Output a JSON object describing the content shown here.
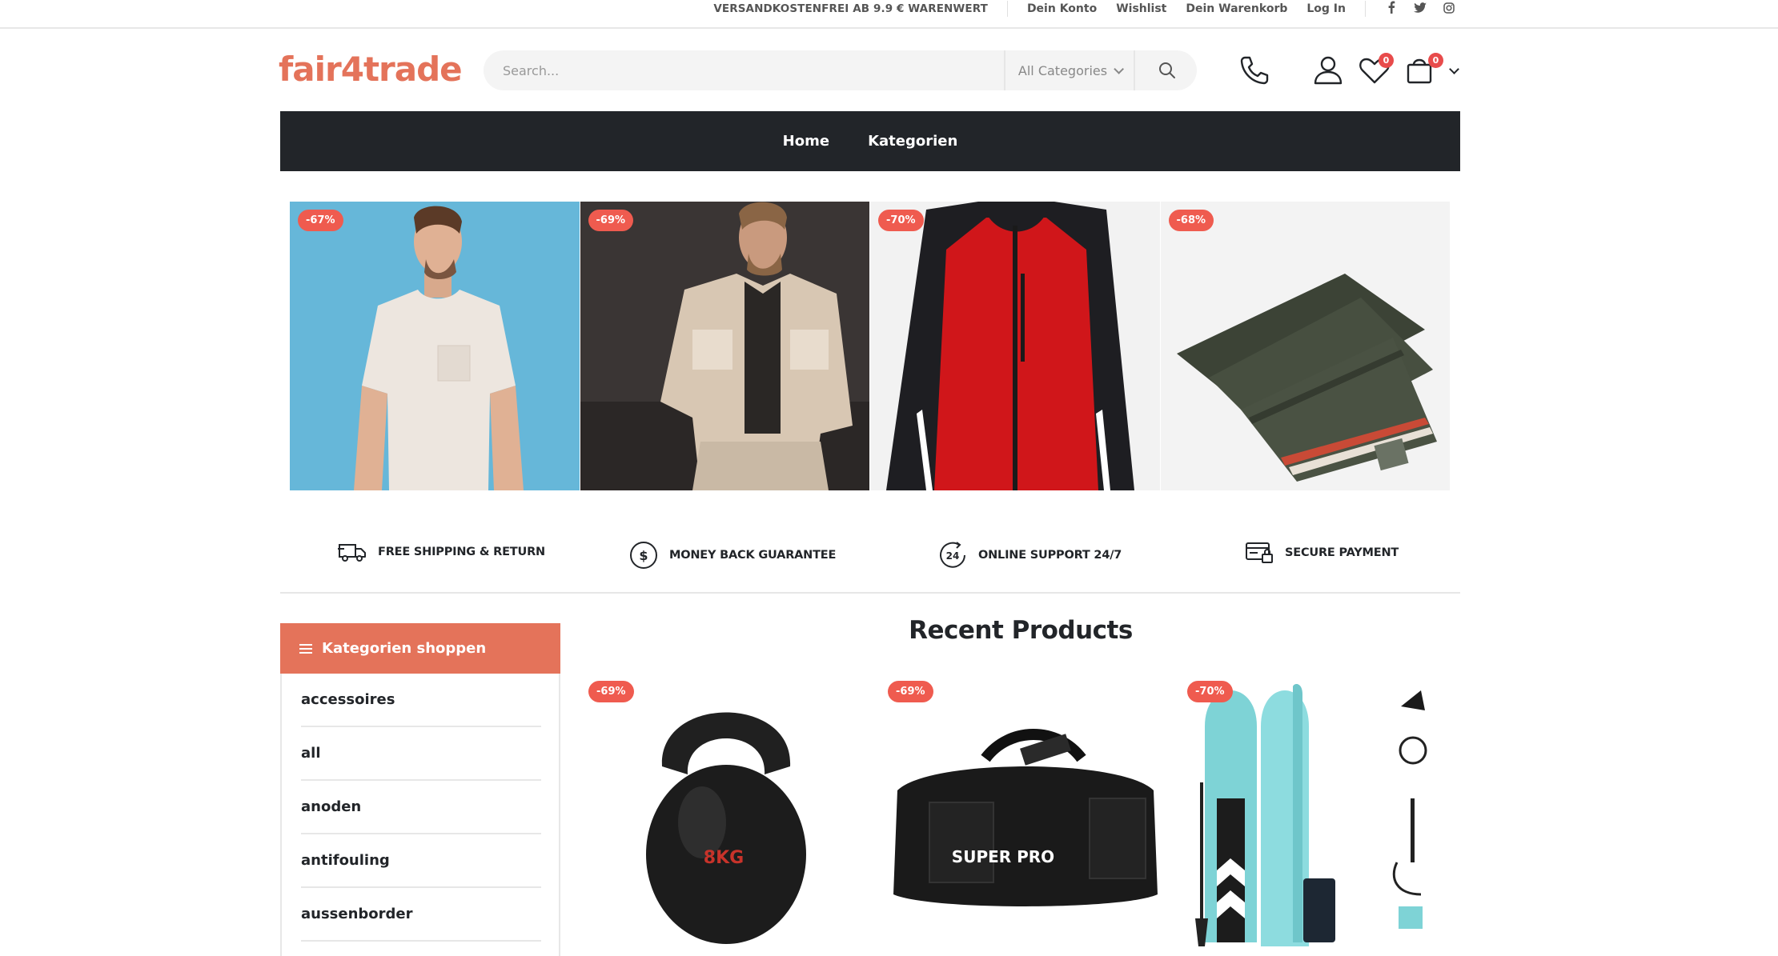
{
  "topbar": {
    "notice": "VERSANDKOSTENFREI AB 9.9 € WARENWERT",
    "links": [
      "Dein Konto",
      "Wishlist",
      "Dein Warenkorb",
      "Log In"
    ],
    "social_icons": [
      "facebook-icon",
      "twitter-icon",
      "instagram-icon"
    ]
  },
  "header": {
    "logo": "fair4trade",
    "search_placeholder": "Search...",
    "category_select": "All Categories",
    "wishlist_count": "0",
    "cart_count": "0"
  },
  "nav": {
    "items": [
      "Home",
      "Kategorien"
    ]
  },
  "banners": [
    {
      "discount": "-67%",
      "image": "tshirt-image"
    },
    {
      "discount": "-69%",
      "image": "sherpa-jacket-image"
    },
    {
      "discount": "-70%",
      "image": "ski-jacket-image"
    },
    {
      "discount": "-68%",
      "image": "scarf-image"
    }
  ],
  "features": [
    {
      "icon": "shipping-truck-icon",
      "label": "FREE SHIPPING & RETURN"
    },
    {
      "icon": "dollar-coin-icon",
      "label": "MONEY BACK GUARANTEE"
    },
    {
      "icon": "support-24-icon",
      "label": "ONLINE SUPPORT 24/7"
    },
    {
      "icon": "secure-payment-icon",
      "label": "SECURE PAYMENT"
    }
  ],
  "sidebar": {
    "title": "Kategorien shoppen",
    "items": [
      "accessoires",
      "all",
      "anoden",
      "antifouling",
      "aussenborder"
    ]
  },
  "recent": {
    "title": "Recent Products",
    "products": [
      {
        "discount": "-69%",
        "image": "kettlebell-image",
        "image_text": "8KG"
      },
      {
        "discount": "-69%",
        "image": "sports-bag-image",
        "image_text": "SUPER PRO"
      },
      {
        "discount": "-70%",
        "image": "paddle-board-image"
      }
    ]
  },
  "colors": {
    "brand": "#e4735a",
    "discount_badge": "#ef5b4f",
    "nav_background": "#222529",
    "badge_red": "#e84b4b"
  }
}
